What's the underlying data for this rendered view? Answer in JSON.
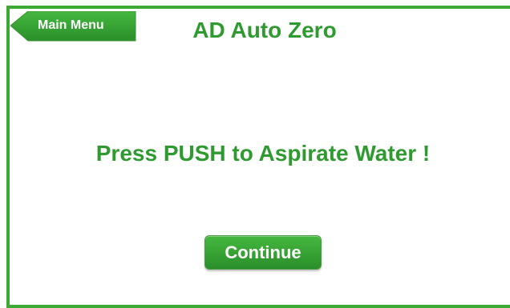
{
  "header": {
    "back_button_label": "Main Menu",
    "title": "AD Auto Zero"
  },
  "main": {
    "instruction": "Press PUSH to Aspirate Water !",
    "continue_label": "Continue"
  },
  "colors": {
    "accent": "#3aaa35",
    "text": "#2e9a30",
    "button_text": "#ffffff"
  },
  "icons": {
    "back_arrow": "left-arrow-tab-icon"
  }
}
